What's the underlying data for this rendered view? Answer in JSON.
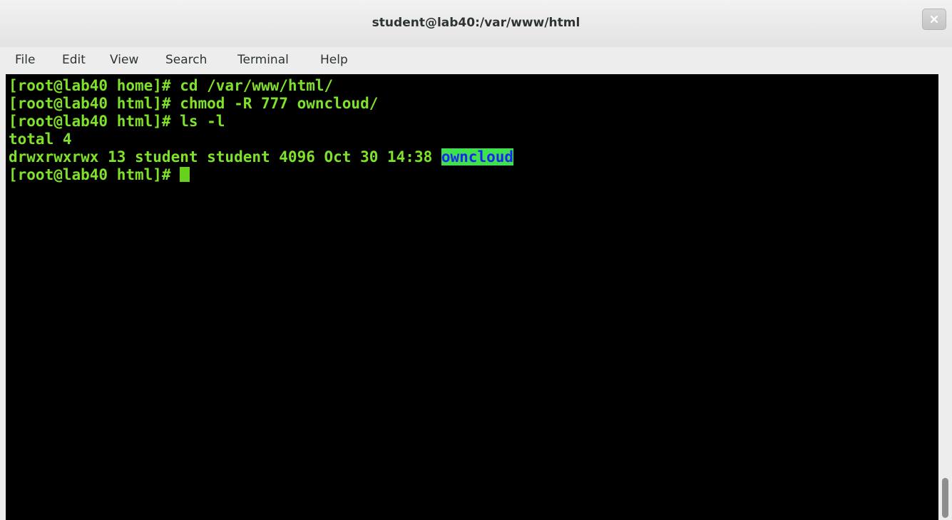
{
  "window": {
    "title": "student@lab40:/var/www/html"
  },
  "menu": {
    "items": [
      "File",
      "Edit",
      "View",
      "Search",
      "Terminal",
      "Help"
    ]
  },
  "terminal": {
    "lines": [
      "[root@lab40 home]# cd /var/www/html/",
      "[root@lab40 html]# chmod -R 777 owncloud/",
      "[root@lab40 html]# ls -l",
      "total 4",
      "drwxrwxrwx 13 student student 4096 Oct 30 14:38 "
    ],
    "highlighted_entry": "owncloud",
    "prompt": "[root@lab40 html]# ",
    "colors": {
      "background": "#000000",
      "text": "#7fe22a",
      "highlight_bg": "#3ee24d",
      "highlight_text": "#1e24f0"
    }
  },
  "icons": {
    "close": "close-icon"
  }
}
